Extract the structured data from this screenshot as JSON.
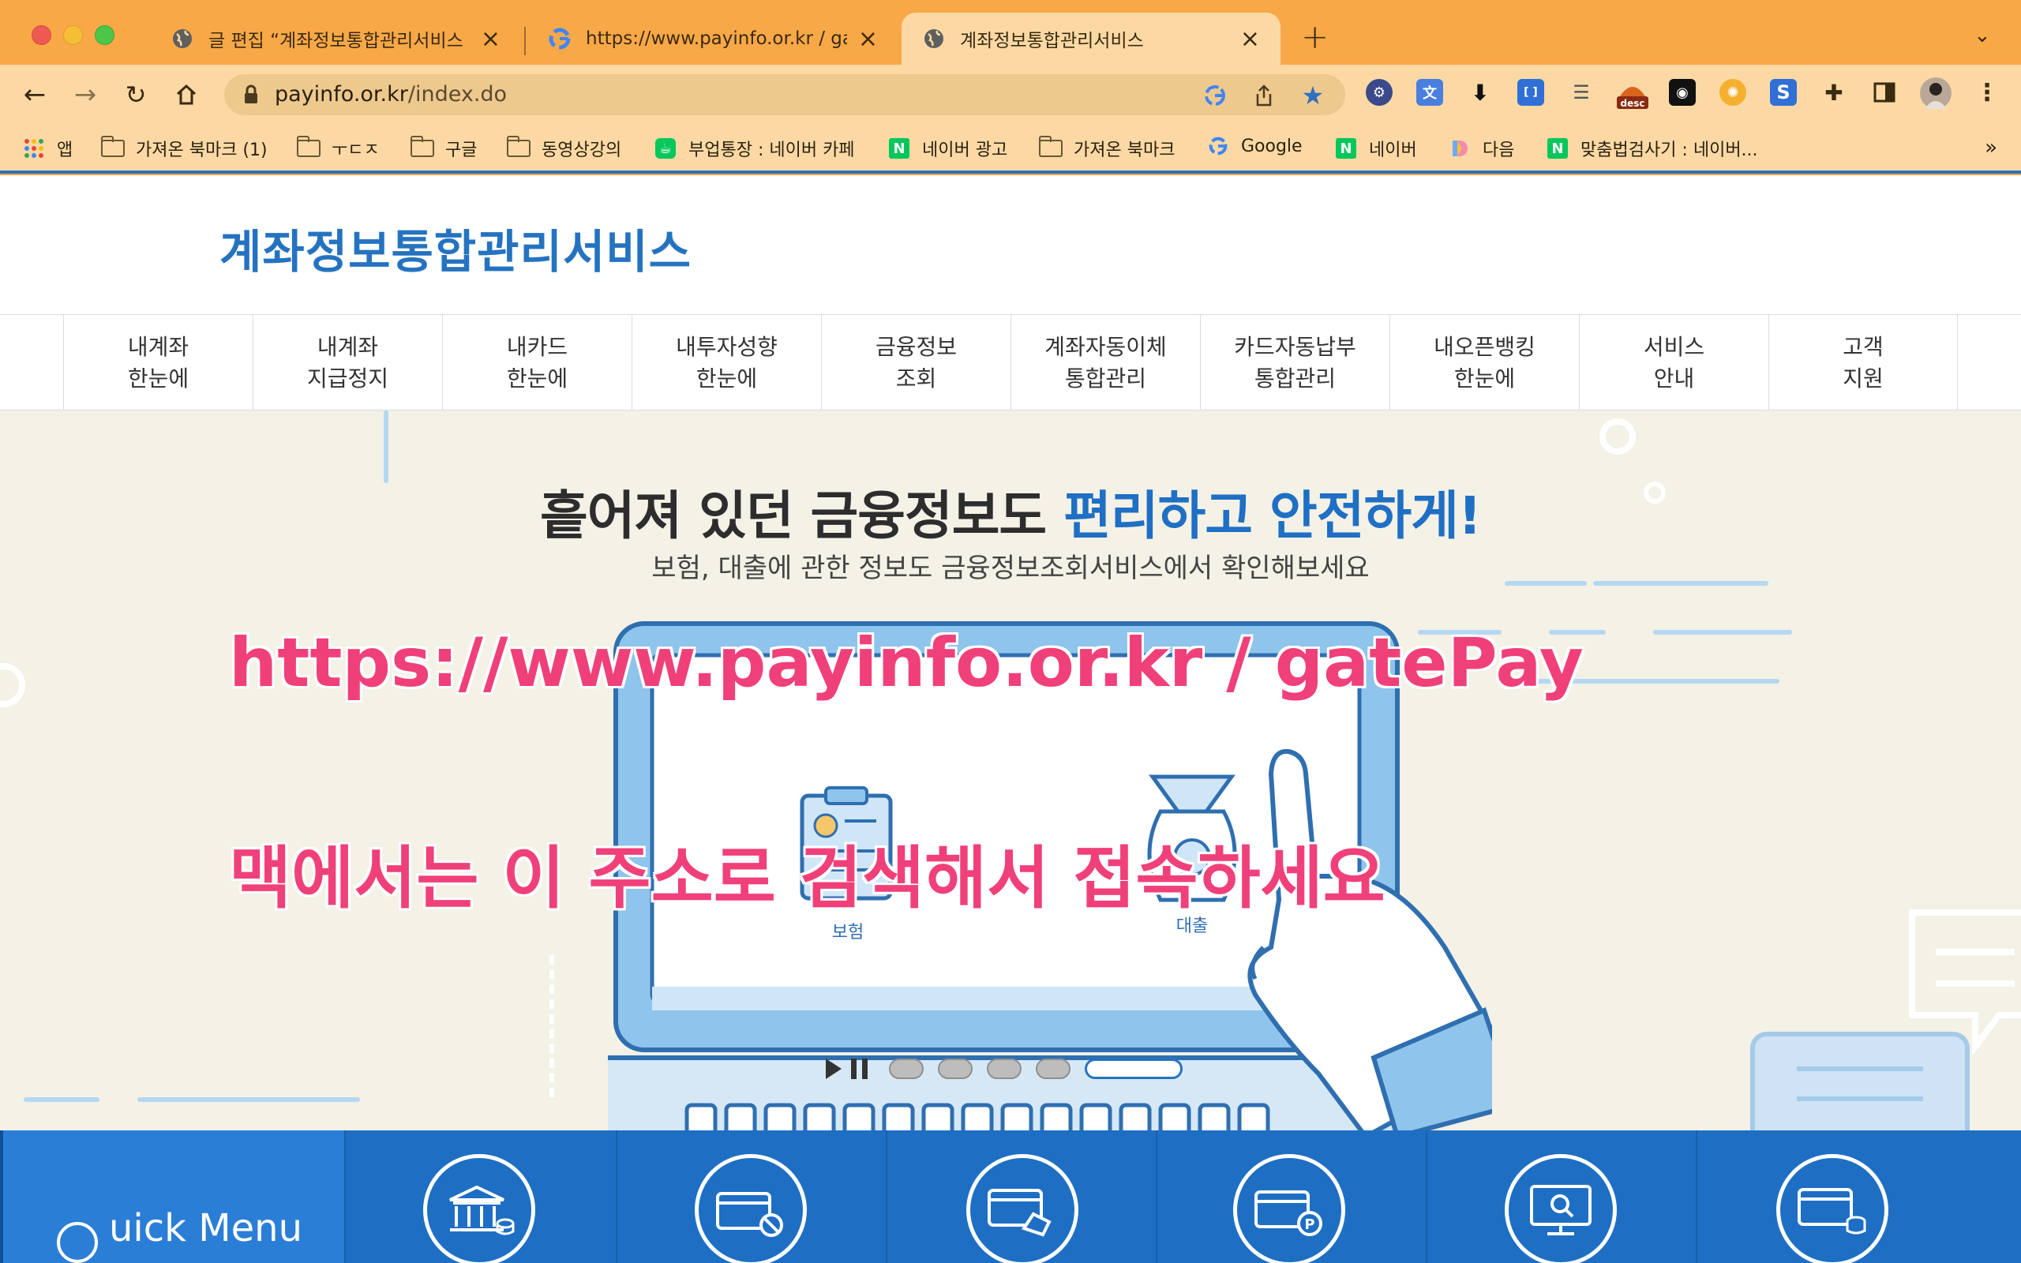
{
  "browser": {
    "tabs": [
      {
        "title": "글 편집 “계좌정보통합관리서비스 휴",
        "favicon": "globe-icon"
      },
      {
        "title": "https://www.payinfo.or.kr / gat",
        "favicon": "google-icon"
      },
      {
        "title": "계좌정보통합관리서비스",
        "favicon": "globe-icon"
      }
    ],
    "active_tab": 2,
    "url_host": "payinfo.or.kr",
    "url_path": "/index.do",
    "bookmarks": [
      {
        "label": "앱",
        "icon": "apps-grid-icon"
      },
      {
        "label": "가져온 북마크 (1)",
        "icon": "folder-icon"
      },
      {
        "label": "ㅜㄷㅈ",
        "icon": "folder-icon"
      },
      {
        "label": "구글",
        "icon": "folder-icon"
      },
      {
        "label": "동영상강의",
        "icon": "folder-icon"
      },
      {
        "label": "부업통장 : 네이버 카페",
        "icon": "naver-cafe-icon"
      },
      {
        "label": "네이버 광고",
        "icon": "naver-icon"
      },
      {
        "label": "가져온 북마크",
        "icon": "folder-icon"
      },
      {
        "label": "Google",
        "icon": "google-icon"
      },
      {
        "label": "네이버",
        "icon": "naver-icon"
      },
      {
        "label": "다음",
        "icon": "daum-icon"
      },
      {
        "label": "맞춤법검사기 : 네이버...",
        "icon": "naver-icon"
      }
    ],
    "ext_badge": "desc",
    "colors": {
      "tabstrip": "#f9a848",
      "toolbar": "#fcd9a4",
      "accent": "#2e6fc0"
    }
  },
  "site": {
    "logo": "계좌정보통합관리서비스",
    "menu": [
      {
        "line1": "내계좌",
        "line2": "한눈에"
      },
      {
        "line1": "내계좌",
        "line2": "지급정지"
      },
      {
        "line1": "내카드",
        "line2": "한눈에"
      },
      {
        "line1": "내투자성향",
        "line2": "한눈에"
      },
      {
        "line1": "금융정보",
        "line2": "조회"
      },
      {
        "line1": "계좌자동이체",
        "line2": "통합관리"
      },
      {
        "line1": "카드자동납부",
        "line2": "통합관리"
      },
      {
        "line1": "내오픈뱅킹",
        "line2": "한눈에"
      },
      {
        "line1": "서비스",
        "line2": "안내"
      },
      {
        "line1": "고객",
        "line2": "지원"
      }
    ],
    "hero": {
      "title_plain": "흩어져 있던 금융정보도 ",
      "title_highlight": "편리하고 안전하게!",
      "subtitle": "보험, 대출에 관한 정보도 금융정보조회서비스에서 확인해보세요",
      "illustration_labels": {
        "insurance": "보험",
        "loan": "대출"
      },
      "slides": 5,
      "active_slide": 5
    },
    "overlay": {
      "line1": "https://www.payinfo.or.kr / gatePay",
      "line2": "맥에서는 이 주소로 검색해서 접속하세요"
    },
    "quick_menu": {
      "label": "uick Menu",
      "icons": [
        "bank-icon",
        "card-cancel-icon",
        "card-transfer-icon",
        "card-payment-icon",
        "monitor-search-icon",
        "card-coin-icon"
      ]
    },
    "colors": {
      "brand_blue": "#2573c0",
      "overlay_pink": "#f0407a",
      "quick_bg": "#1e6fc4"
    }
  }
}
